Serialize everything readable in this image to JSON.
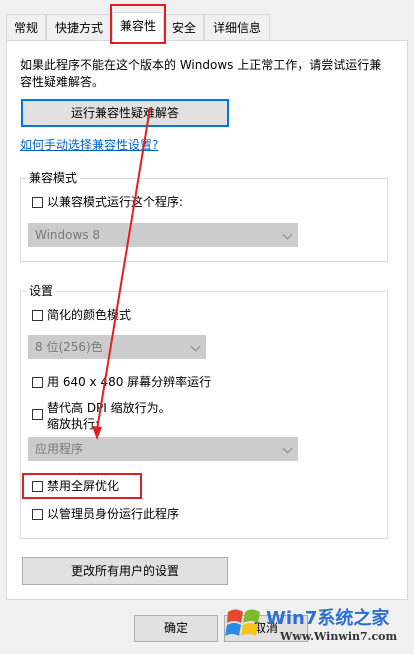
{
  "tabs": [
    {
      "label": "常规"
    },
    {
      "label": "快捷方式"
    },
    {
      "label": "兼容性"
    },
    {
      "label": "安全"
    },
    {
      "label": "详细信息"
    }
  ],
  "intro_text_line1": "如果此程序不能在这个版本的 Windows 上正常工作，请尝试运行兼",
  "intro_text_line2": "容性疑难解答。",
  "troubleshoot_button": "运行兼容性疑难解答",
  "manual_link": "如何手动选择兼容性设置?",
  "compat_mode": {
    "legend": "兼容模式",
    "checkbox_label": "以兼容模式运行这个程序:",
    "select_value": "Windows 8"
  },
  "settings": {
    "legend": "设置",
    "reduced_color_label": "简化的颜色模式",
    "color_select_value": "8 位(256)色",
    "res_640_label": "用 640 x 480 屏幕分辨率运行",
    "dpi_label_line1": "替代高 DPI 缩放行为。",
    "dpi_label_line2": "缩放执行:",
    "dpi_select_value": "应用程序",
    "fullscreen_opt_label": "禁用全屏优化",
    "admin_label": "以管理员身份运行此程序"
  },
  "change_all_button": "更改所有用户的设置",
  "ok_button": "确定",
  "cancel_button": "取消",
  "watermark": {
    "brand": "Win7系统之家",
    "url": "Www.Winwin7.com"
  },
  "colors": {
    "highlight": "#e02020",
    "link": "#0066cc",
    "focus": "#0078d7"
  }
}
